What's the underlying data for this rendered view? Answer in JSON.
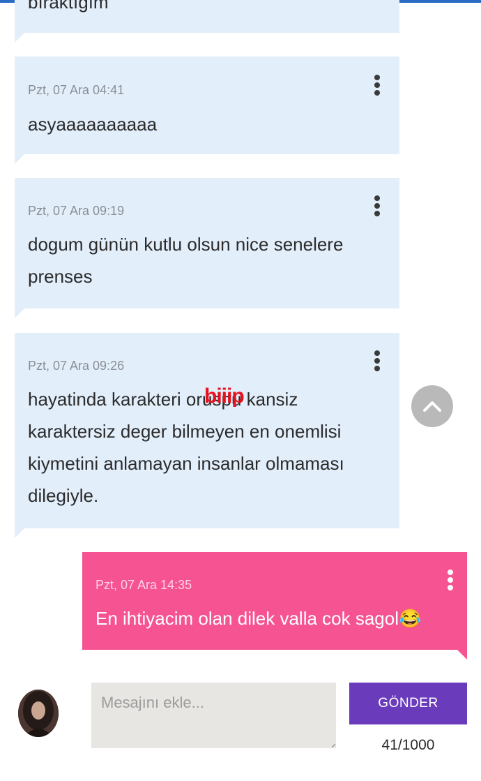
{
  "messages": [
    {
      "time": "",
      "text": "bıraktığım"
    },
    {
      "time": "Pzt, 07 Ara 04:41",
      "text": "asyaaaaaaaaaa"
    },
    {
      "time": "Pzt, 07 Ara 09:19",
      "lines": [
        "dogum günün kutlu olsun nice senelere",
        "prenses"
      ]
    },
    {
      "time": "Pzt, 07 Ara 09:26",
      "lines": [
        "hayatinda karakteri oruspu kansiz",
        "karaktersiz deger bilmeyen en onemlisi",
        "kiymetini anlamayan insanlar olmaması",
        "dilegiyle."
      ],
      "censor_label": "biiip"
    },
    {
      "time": "Pzt, 07 Ara 14:35",
      "text": "En ihtiyacim olan dilek valla cok sagol😂",
      "own": true
    }
  ],
  "composer": {
    "placeholder": "Mesajını ekle...",
    "send_label": "GÖNDER",
    "counter": "41/1000"
  },
  "colors": {
    "incoming_bubble": "#e3eefb",
    "outgoing_bubble": "#f55392",
    "send_button": "#6a3cbc",
    "censor": "#e8101b"
  },
  "icons": {
    "message_menu": "kebab-vertical-icon",
    "scroll_top": "chevron-up-icon"
  }
}
